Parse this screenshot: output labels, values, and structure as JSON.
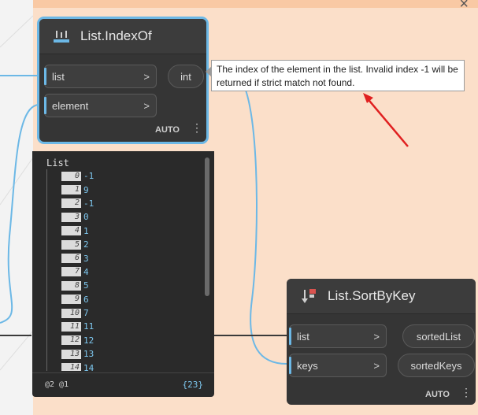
{
  "node_indexof": {
    "title": "List.IndexOf",
    "inputs": [
      {
        "label": "list",
        "chev": ">"
      },
      {
        "label": "element",
        "chev": ">"
      }
    ],
    "output": "int",
    "lacing": "AUTO",
    "icon": "list-index-icon"
  },
  "tooltip": {
    "text": "The index of the element in the list. Invalid index -1 will be returned if strict match not found."
  },
  "preview": {
    "title": "List",
    "rows": [
      {
        "index": "0",
        "value": "-1"
      },
      {
        "index": "1",
        "value": "9"
      },
      {
        "index": "2",
        "value": "-1"
      },
      {
        "index": "3",
        "value": "0"
      },
      {
        "index": "4",
        "value": "1"
      },
      {
        "index": "5",
        "value": "2"
      },
      {
        "index": "6",
        "value": "3"
      },
      {
        "index": "7",
        "value": "4"
      },
      {
        "index": "8",
        "value": "5"
      },
      {
        "index": "9",
        "value": "6"
      },
      {
        "index": "10",
        "value": "7"
      },
      {
        "index": "11",
        "value": "11"
      },
      {
        "index": "12",
        "value": "12"
      },
      {
        "index": "13",
        "value": "13"
      },
      {
        "index": "14",
        "value": "14"
      }
    ],
    "levels": "@2 @1",
    "count": "{23}"
  },
  "node_sortbykey": {
    "title": "List.SortByKey",
    "inputs": [
      {
        "label": "list",
        "chev": ">"
      },
      {
        "label": "keys",
        "chev": ">"
      }
    ],
    "outputs": [
      "sortedList",
      "sortedKeys"
    ],
    "lacing": "AUTO",
    "icon": "sort-by-key-icon"
  },
  "colors": {
    "group_background": "#fbdfc9",
    "node_body": "#353535",
    "selection": "#6cb8e6",
    "wire": "#6cb8e6",
    "annotation_arrow": "#e02020"
  }
}
